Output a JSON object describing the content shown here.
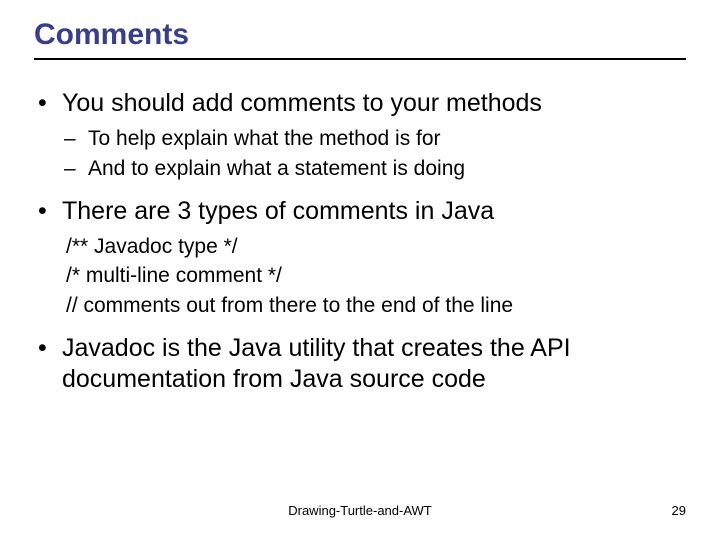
{
  "title": "Comments",
  "bullets": [
    {
      "text": "You should add comments to your methods",
      "sub_style": "dash",
      "sub": [
        "To help explain what the method is for",
        "And to explain what a statement is doing"
      ]
    },
    {
      "text": "There are 3 types of comments in Java",
      "sub_style": "plain",
      "sub": [
        "/** Javadoc type */",
        "/* multi-line comment */",
        "// comments out from there to the end of the line"
      ]
    },
    {
      "text": "Javadoc is the Java utility that creates the API documentation from Java source code",
      "sub_style": "plain",
      "sub": []
    }
  ],
  "footer": "Drawing-Turtle-and-AWT",
  "page_number": "29"
}
